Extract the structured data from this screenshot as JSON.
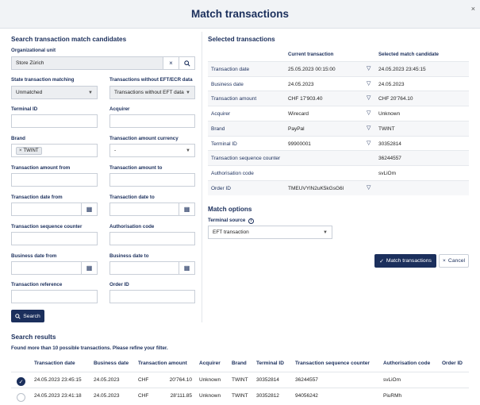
{
  "header": {
    "title": "Match transactions",
    "close": "×"
  },
  "search_form": {
    "heading": "Search transaction match candidates",
    "org_unit": {
      "label": "Organizational unit",
      "value": "Store Zürich"
    },
    "state_matching": {
      "label": "State transaction matching",
      "value": "Unmatched"
    },
    "without_eft": {
      "label": "Transactions without EFT/ECR data",
      "value": "Transactions without EFT data"
    },
    "terminal_id": {
      "label": "Terminal ID",
      "value": ""
    },
    "acquirer": {
      "label": "Acquirer",
      "value": ""
    },
    "brand": {
      "label": "Brand",
      "tag": "TWINT"
    },
    "amount_currency": {
      "label": "Transaction amount currency",
      "value": "-"
    },
    "amount_from": {
      "label": "Transaction amount from",
      "value": ""
    },
    "amount_to": {
      "label": "Transaction amount to",
      "value": ""
    },
    "date_from": {
      "label": "Transaction date from",
      "value": ""
    },
    "date_to": {
      "label": "Transaction date to",
      "value": ""
    },
    "seq_counter": {
      "label": "Transaction sequence counter",
      "value": ""
    },
    "auth_code": {
      "label": "Authorisation code",
      "value": ""
    },
    "business_from": {
      "label": "Business date from",
      "value": ""
    },
    "business_to": {
      "label": "Business date to",
      "value": ""
    },
    "reference": {
      "label": "Transaction reference",
      "value": ""
    },
    "order_id": {
      "label": "Order ID",
      "value": ""
    },
    "search_button": "Search"
  },
  "selected": {
    "heading": "Selected transactions",
    "col_current": "Current transaction",
    "col_candidate": "Selected match candidate",
    "rows": [
      {
        "label": "Transaction date",
        "current": "25.05.2023 00:15:00",
        "candidate": "24.05.2023 23:45:15",
        "filter": true
      },
      {
        "label": "Business date",
        "current": "24.05.2023",
        "candidate": "24.05.2023",
        "filter": true
      },
      {
        "label": "Transaction amount",
        "current": "CHF 17'903.40",
        "candidate": "CHF 20'764.10",
        "filter": true
      },
      {
        "label": "Acquirer",
        "current": "Wirecard",
        "candidate": "Unknown",
        "filter": true
      },
      {
        "label": "Brand",
        "current": "PayPal",
        "candidate": "TWINT",
        "filter": true
      },
      {
        "label": "Terminal ID",
        "current": "99900001",
        "candidate": "30352814",
        "filter": true
      },
      {
        "label": "Transaction sequence counter",
        "current": "",
        "candidate": "36244557",
        "filter": false
      },
      {
        "label": "Authorisation code",
        "current": "",
        "candidate": "svLiOm",
        "filter": false
      },
      {
        "label": "Order ID",
        "current": "TMEUVYlN2uK5kGsG6l",
        "candidate": "",
        "filter": true
      }
    ]
  },
  "match_options": {
    "heading": "Match options",
    "terminal_source_label": "Terminal source",
    "terminal_source_value": "EFT transaction",
    "match_button": "Match transactions",
    "cancel_button": "Cancel"
  },
  "results": {
    "heading": "Search results",
    "notice": "Found more than 10 possible transactions. Please refine your filter.",
    "columns": [
      "Transaction date",
      "Business date",
      "Transaction amount",
      "Acquirer",
      "Brand",
      "Terminal ID",
      "Transaction sequence counter",
      "Authorisation code",
      "Order ID"
    ],
    "rows": [
      {
        "selected": true,
        "date": "24.05.2023 23:45:15",
        "business": "24.05.2023",
        "currency": "CHF",
        "amount": "20'764.10",
        "acquirer": "Unknown",
        "brand": "TWINT",
        "terminal": "30352814",
        "seq": "36244557",
        "auth": "svLiOm",
        "order": ""
      },
      {
        "selected": false,
        "date": "24.05.2023 23:41:18",
        "business": "24.05.2023",
        "currency": "CHF",
        "amount": "28'111.85",
        "acquirer": "Unknown",
        "brand": "TWINT",
        "terminal": "30352812",
        "seq": "94056242",
        "auth": "PiuRMh",
        "order": ""
      }
    ]
  }
}
